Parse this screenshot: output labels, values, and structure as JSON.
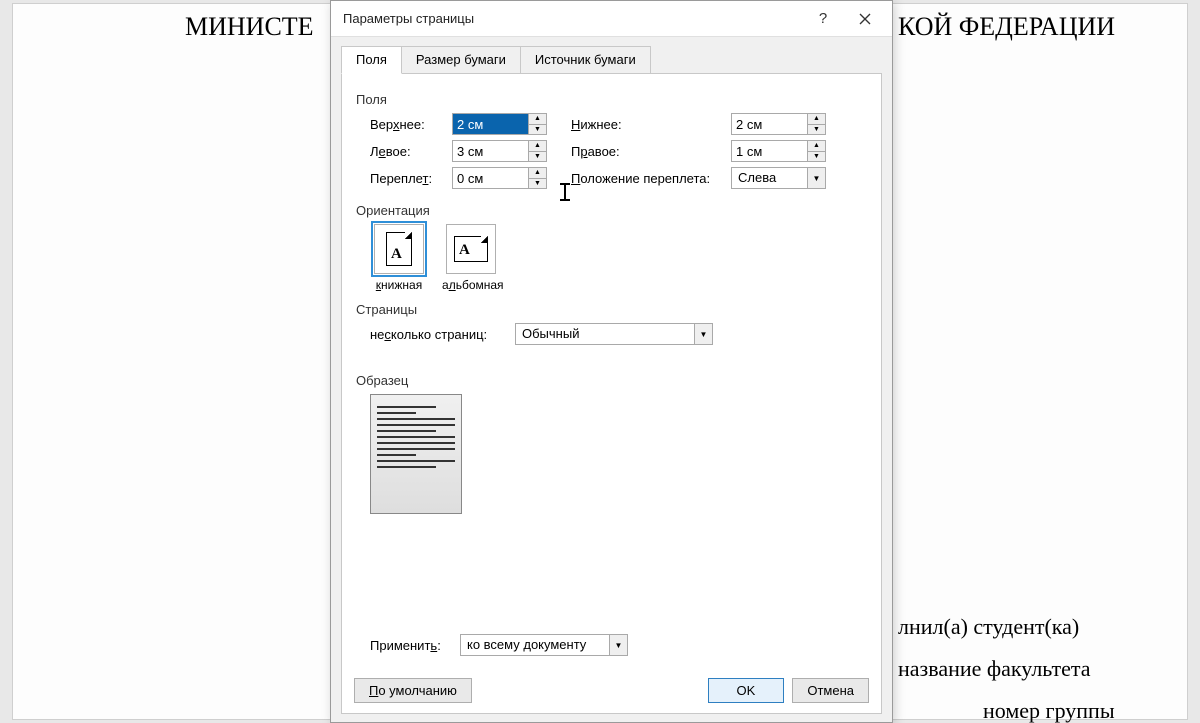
{
  "document": {
    "title_left": "МИНИСТЕ",
    "title_right": "КОЙ ФЕДЕРАЦИИ",
    "line1": "лнил(а) студент(ка)",
    "line2": "название факультета",
    "line3": "номер группы"
  },
  "dialog": {
    "title": "Параметры страницы",
    "tabs": [
      "Поля",
      "Размер бумаги",
      "Источник бумаги"
    ],
    "active_tab": 0,
    "groups": {
      "margins": "Поля",
      "orientation": "Ориентация",
      "pages": "Страницы",
      "preview": "Образец"
    },
    "margins": {
      "top_label": "Верхнее:",
      "top_value": "2 см",
      "bottom_label": "Нижнее:",
      "bottom_value": "2 см",
      "left_label": "Левое:",
      "left_value": "3 см",
      "right_label": "Правое:",
      "right_value": "1 см",
      "gutter_label": "Переплет:",
      "gutter_value": "0 см",
      "gutter_pos_label": "Положение переплета:",
      "gutter_pos_value": "Слева"
    },
    "orientation": {
      "portrait": "книжная",
      "landscape": "альбомная"
    },
    "pages": {
      "multi_label": "несколько страниц:",
      "multi_value": "Обычный"
    },
    "apply": {
      "label": "Применить:",
      "value": "ко всему документу"
    },
    "buttons": {
      "default": "По умолчанию",
      "ok": "OK",
      "cancel": "Отмена"
    }
  }
}
